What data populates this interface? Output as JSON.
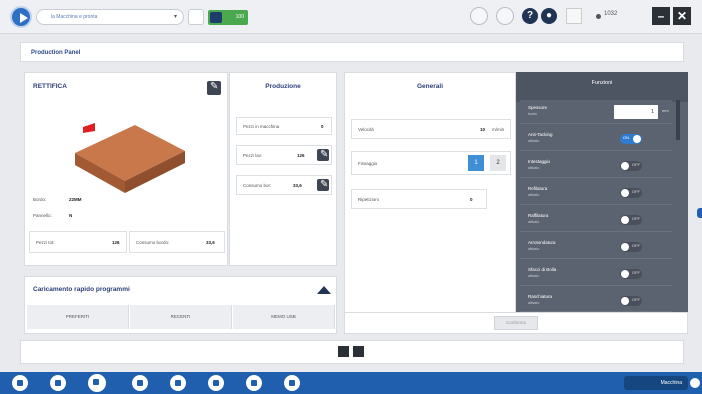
{
  "toolbar": {
    "url_text": "la Macchina e pronta",
    "green_badge": "100",
    "time": "1032"
  },
  "page_title": "Production Panel",
  "machine": {
    "name": "RETTIFICA",
    "bordo_label": "Bordo:",
    "bordo_value": "22MM",
    "pannello_label": "Pannello:",
    "pannello_value": "N",
    "pezzi_label": "Pezzi tot:",
    "pezzi_value": "126",
    "consumo_label": "Consumo bordo:",
    "consumo_value": "33,6"
  },
  "produzione": {
    "title": "Produzione",
    "rows": [
      {
        "label": "Pezzi in macchina",
        "value": "0"
      },
      {
        "label": "Pezzi lav:",
        "value": "126"
      },
      {
        "label": "Consumo bor:",
        "value": "33,6"
      }
    ]
  },
  "caricamento": {
    "title": "Caricamento rapido programmi",
    "tabs": [
      "PREFERITI",
      "RECENTI",
      "MEMO USB"
    ]
  },
  "generali": {
    "title": "Generali",
    "velocita_label": "Velocità",
    "velocita_value": "10",
    "velocita_unit": "m/min",
    "fissaggio_label": "Fissaggio",
    "fissaggio_opts": [
      "1",
      "2"
    ],
    "ripetizioni_label": "Ripetizioni",
    "ripetizioni_value": "0",
    "confirm": "Conferma"
  },
  "funzioni": {
    "title": "Funzioni",
    "spessore_label": "Spessore",
    "spessore_sub": "bordo",
    "spessore_value": "1",
    "spessore_unit": "mm",
    "items": [
      {
        "label": "Anti-Tacking",
        "sub": "attivato",
        "state": "ON"
      },
      {
        "label": "Intestaggio",
        "sub": "attivato",
        "state": "OFF"
      },
      {
        "label": "Refilatura",
        "sub": "attivato",
        "state": "OFF"
      },
      {
        "label": "Raffilatura",
        "sub": "attivato",
        "state": "OFF"
      },
      {
        "label": "Arrotondatura",
        "sub": "attivato",
        "state": "OFF"
      },
      {
        "label": "Sfacci di Bolla",
        "sub": "attivato",
        "state": "OFF"
      },
      {
        "label": "Raschiatura",
        "sub": "attivato",
        "state": "OFF"
      }
    ]
  },
  "status": {
    "label": "Macchina"
  },
  "colors": {
    "accent": "#2f6fc4",
    "panel_dark": "#5c6370",
    "taskbar": "#1f5fae"
  }
}
